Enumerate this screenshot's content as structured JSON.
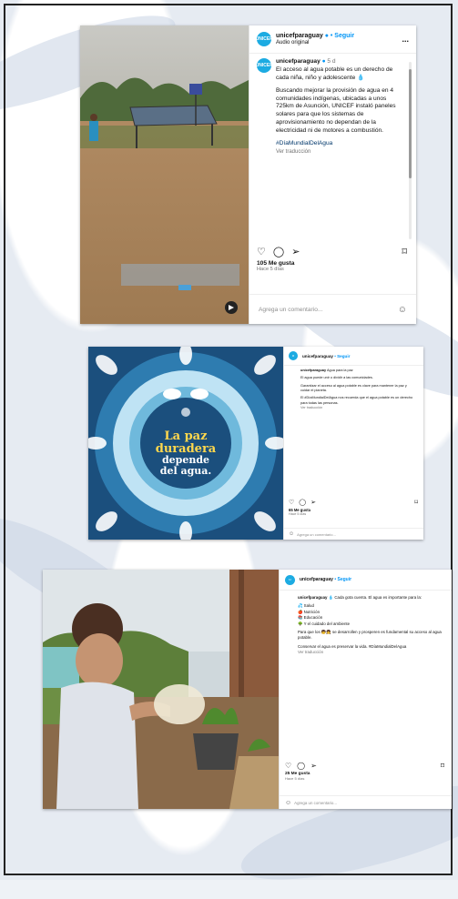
{
  "post1": {
    "username": "unicefparaguay",
    "follow_label": "• Seguir",
    "subtitle": "Audio original",
    "caption_username": "unicefparaguay",
    "caption_time": "5 d",
    "caption_line1": "El acceso al agua potable es un derecho de cada niña, niño y adolescente 💧",
    "caption_line2": "Buscando mejorar la provisión de agua en 4 comunidades indígenas, ubicadas a unos 725km de Asunción, UNICEF instaló paneles solares para que los sistemas de aprovisionamiento no dependan de la electricidad ni de motores a combustión.",
    "hashtag": "#DíaMundialDelAgua",
    "translate": "Ver traducción",
    "likes": "105 Me gusta",
    "time": "Hace 5 días",
    "comment_placeholder": "Agrega un comentario...",
    "more": "..."
  },
  "post2": {
    "username": "unicefparaguay",
    "follow_label": "• Seguir",
    "caption_username": "unicefparaguay",
    "caption_first": "Agua para la paz",
    "caption_line1": "El agua puede unir o dividir a las comunidades.",
    "caption_line2": "Garantizar el acceso al agua potable es clave para mantener la paz y cuidar el planeta.",
    "caption_line3": "El #DíaMundialDelAgua nos recuerda que el agua potable es un derecho para todas las personas.",
    "translate": "Ver traducción",
    "likes": "65 Me gusta",
    "time": "Hace 5 días",
    "comment_placeholder": "Agrega un comentario...",
    "image_line1": "La paz",
    "image_line2": "duradera",
    "image_line3": "depende",
    "image_line4": "del agua."
  },
  "post3": {
    "username": "unicefparaguay",
    "follow_label": "• Seguir",
    "caption_username": "unicefparaguay",
    "caption_intro": "💧 Cada gota cuenta. El agua es importante para la:",
    "list": [
      "💦 Salud",
      "🍎 Nutrición",
      "📚 Educación",
      "🌳 Y el cuidado del ambiente"
    ],
    "caption_line2": "Para que los 🧒👧 se desarrollen y prosperen es fundamental su acceso al agua potable.",
    "caption_line3": "Conservar el agua es preservar la vida. #DíaMundialDelAgua",
    "translate": "Ver traducción",
    "likes": "25 Me gusta",
    "time": "Hace 5 días",
    "comment_placeholder": "Agrega un comentario..."
  },
  "colors": {
    "accent": "#0095f6",
    "unicef": "#1cabe2",
    "poster_bg": "#1b4f7d",
    "poster_text": "#ffd84d"
  }
}
